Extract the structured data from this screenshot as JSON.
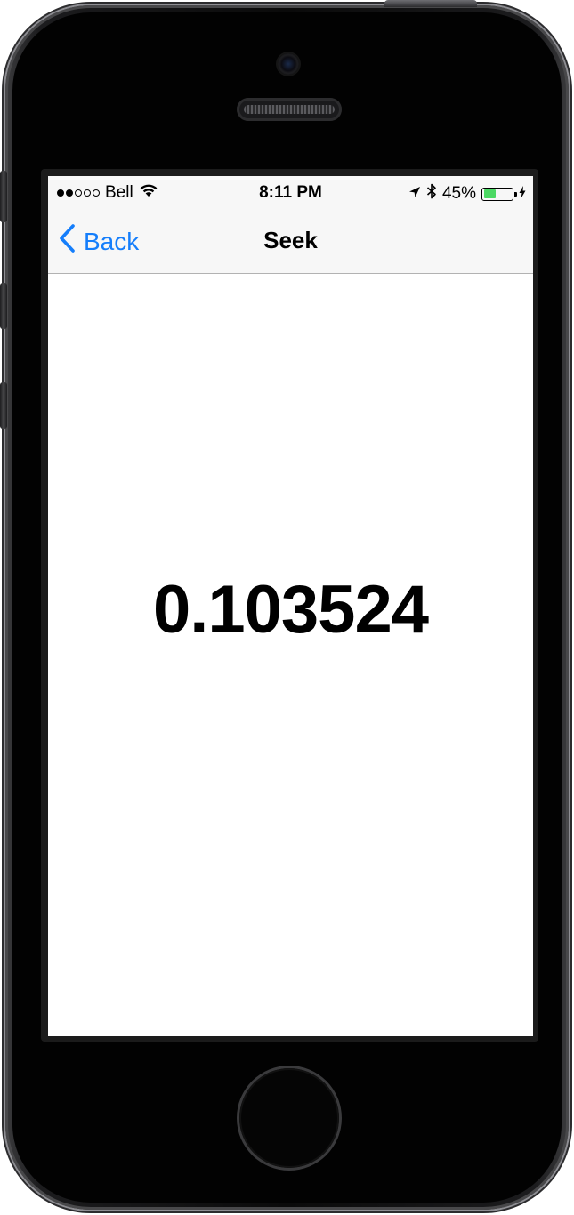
{
  "status_bar": {
    "carrier": "Bell",
    "signal_bars_total": 5,
    "signal_bars_filled": 2,
    "time": "8:11 PM",
    "battery_percent_text": "45%",
    "battery_level": 0.45,
    "battery_color": "#4cd964",
    "icons": [
      "wifi-icon",
      "location-arrow-icon",
      "bluetooth-icon",
      "battery-icon",
      "charging-bolt-icon"
    ]
  },
  "nav_bar": {
    "back_label": "Back",
    "title": "Seek",
    "accent_color": "#157efb"
  },
  "main": {
    "value": "0.103524"
  }
}
